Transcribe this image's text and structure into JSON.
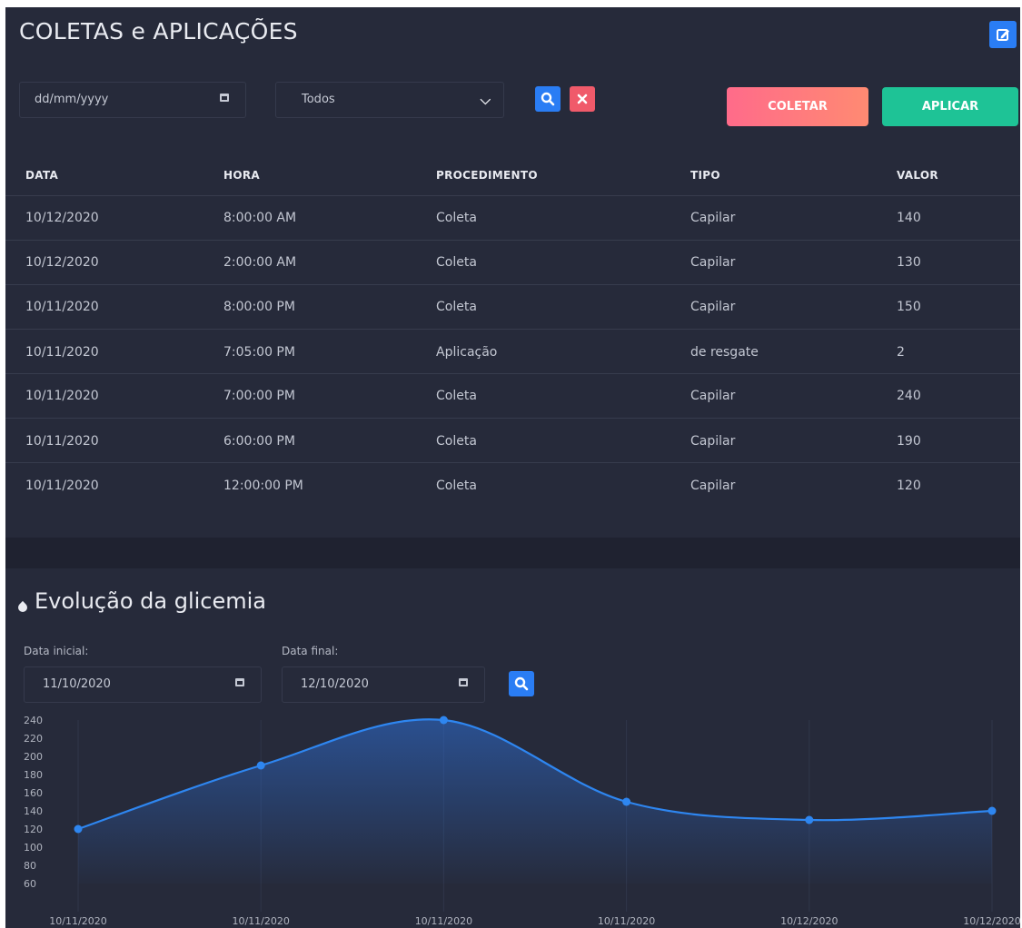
{
  "page": {
    "title": "COLETAS e APLICAÇÕES",
    "edit_icon": "edit-icon"
  },
  "filters": {
    "date_placeholder": "dd/mm/yyyy",
    "type_select_value": "Todos",
    "search_icon": "search-icon",
    "clear_icon": "close-icon"
  },
  "actions": {
    "coletar_label": "COLETAR",
    "aplicar_label": "APLICAR",
    "colors": {
      "coletar": "#ff7480",
      "aplicar": "#1ec396",
      "search": "#2a7df4",
      "clear": "#f05a6a"
    }
  },
  "table": {
    "headers": [
      "DATA",
      "HORA",
      "PROCEDIMENTO",
      "TIPO",
      "VALOR"
    ],
    "rows": [
      [
        "10/12/2020",
        "8:00:00 AM",
        "Coleta",
        "Capilar",
        "140"
      ],
      [
        "10/12/2020",
        "2:00:00 AM",
        "Coleta",
        "Capilar",
        "130"
      ],
      [
        "10/11/2020",
        "8:00:00 PM",
        "Coleta",
        "Capilar",
        "150"
      ],
      [
        "10/11/2020",
        "7:05:00 PM",
        "Aplicação",
        "de resgate",
        "2"
      ],
      [
        "10/11/2020",
        "7:00:00 PM",
        "Coleta",
        "Capilar",
        "240"
      ],
      [
        "10/11/2020",
        "6:00:00 PM",
        "Coleta",
        "Capilar",
        "190"
      ],
      [
        "10/11/2020",
        "12:00:00 PM",
        "Coleta",
        "Capilar",
        "120"
      ]
    ]
  },
  "evolution": {
    "title": "Evolução da glicemia",
    "title_icon": "drop-icon",
    "start_label": "Data inicial:",
    "start_value": "11/10/2020",
    "end_label": "Data final:",
    "end_value": "12/10/2020"
  },
  "chart_data": {
    "type": "area",
    "x": [
      "10/11/2020",
      "10/11/2020",
      "10/11/2020",
      "10/11/2020",
      "10/12/2020",
      "10/12/2020"
    ],
    "series": [
      {
        "values": [
          120,
          190,
          240,
          150,
          130,
          140
        ]
      }
    ],
    "y_ticks": [
      60,
      80,
      100,
      120,
      140,
      160,
      180,
      200,
      220,
      240
    ],
    "ylim": [
      60,
      240
    ],
    "grid": "vertical",
    "line_color": "#2e86f0"
  }
}
